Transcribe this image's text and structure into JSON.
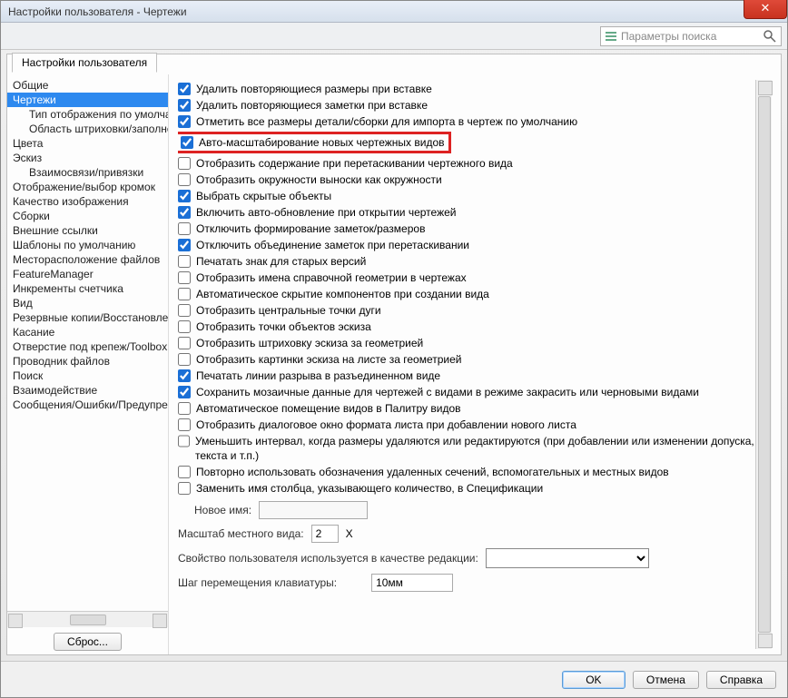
{
  "title": "Настройки пользователя - Чертежи",
  "search_placeholder": "Параметры поиска",
  "tab": "Настройки пользователя",
  "reset_label": "Сброс...",
  "sidebar": [
    {
      "label": "Общие",
      "sub": false,
      "sel": false
    },
    {
      "label": "Чертежи",
      "sub": false,
      "sel": true
    },
    {
      "label": "Тип отображения по умолчанию",
      "sub": true,
      "sel": false
    },
    {
      "label": "Область штриховки/заполнения",
      "sub": true,
      "sel": false
    },
    {
      "label": "Цвета",
      "sub": false,
      "sel": false
    },
    {
      "label": "Эскиз",
      "sub": false,
      "sel": false
    },
    {
      "label": "Взаимосвязи/привязки",
      "sub": true,
      "sel": false
    },
    {
      "label": "Отображение/выбор кромок",
      "sub": false,
      "sel": false
    },
    {
      "label": "Качество изображения",
      "sub": false,
      "sel": false
    },
    {
      "label": "Сборки",
      "sub": false,
      "sel": false
    },
    {
      "label": "Внешние ссылки",
      "sub": false,
      "sel": false
    },
    {
      "label": "Шаблоны по умолчанию",
      "sub": false,
      "sel": false
    },
    {
      "label": "Месторасположение файлов",
      "sub": false,
      "sel": false
    },
    {
      "label": "FeatureManager",
      "sub": false,
      "sel": false
    },
    {
      "label": "Инкременты счетчика",
      "sub": false,
      "sel": false
    },
    {
      "label": "Вид",
      "sub": false,
      "sel": false
    },
    {
      "label": "Резервные копии/Восстановление",
      "sub": false,
      "sel": false
    },
    {
      "label": "Касание",
      "sub": false,
      "sel": false
    },
    {
      "label": "Отверстие под крепеж/Toolbox",
      "sub": false,
      "sel": false
    },
    {
      "label": "Проводник файлов",
      "sub": false,
      "sel": false
    },
    {
      "label": "Поиск",
      "sub": false,
      "sel": false
    },
    {
      "label": "Взаимодействие",
      "sub": false,
      "sel": false
    },
    {
      "label": "Сообщения/Ошибки/Предупреждения",
      "sub": false,
      "sel": false
    }
  ],
  "options": [
    {
      "label": "Удалить повторяющиеся размеры при вставке",
      "checked": true,
      "hl": false
    },
    {
      "label": "Удалить повторяющиеся заметки при вставке",
      "checked": true,
      "hl": false
    },
    {
      "label": "Отметить все размеры детали/сборки для импорта в чертеж по умолчанию",
      "checked": true,
      "hl": false
    },
    {
      "label": "Авто-масштабирование новых чертежных видов",
      "checked": true,
      "hl": true
    },
    {
      "label": "Отобразить содержание при перетаскивании чертежного вида",
      "checked": false,
      "hl": false
    },
    {
      "label": "Отобразить окружности выноски как окружности",
      "checked": false,
      "hl": false
    },
    {
      "label": "Выбрать скрытые объекты",
      "checked": true,
      "hl": false
    },
    {
      "label": "Включить авто-обновление при открытии чертежей",
      "checked": true,
      "hl": false
    },
    {
      "label": "Отключить формирование заметок/размеров",
      "checked": false,
      "hl": false
    },
    {
      "label": "Отключить объединение заметок при перетаскивании",
      "checked": true,
      "hl": false
    },
    {
      "label": "Печатать знак для старых версий",
      "checked": false,
      "hl": false
    },
    {
      "label": "Отобразить имена справочной геометрии в чертежах",
      "checked": false,
      "hl": false
    },
    {
      "label": "Автоматическое скрытие компонентов при создании вида",
      "checked": false,
      "hl": false
    },
    {
      "label": "Отобразить центральные точки дуги",
      "checked": false,
      "hl": false
    },
    {
      "label": "Отобразить точки объектов эскиза",
      "checked": false,
      "hl": false
    },
    {
      "label": "Отобразить штриховку эскиза за геометрией",
      "checked": false,
      "hl": false
    },
    {
      "label": "Отобразить картинки эскиза на листе за геометрией",
      "checked": false,
      "hl": false
    },
    {
      "label": "Печатать линии разрыва в разъединенном виде",
      "checked": true,
      "hl": false
    },
    {
      "label": "Сохранить мозаичные данные для чертежей с видами в режиме закрасить или черновыми видами",
      "checked": true,
      "hl": false
    },
    {
      "label": "Автоматическое помещение видов в Палитру видов",
      "checked": false,
      "hl": false
    },
    {
      "label": "Отобразить диалоговое окно формата листа при добавлении нового листа",
      "checked": false,
      "hl": false
    },
    {
      "label": "Уменьшить интервал, когда размеры удаляются или редактируются (при добавлении или изменении допуска, текста и т.п.)",
      "checked": false,
      "hl": false
    },
    {
      "label": "Повторно использовать обозначения удаленных сечений, вспомогательных и местных видов",
      "checked": false,
      "hl": false
    },
    {
      "label": "Заменить имя столбца, указывающего количество, в Спецификации",
      "checked": false,
      "hl": false
    }
  ],
  "newname_label": "Новое имя:",
  "local_scale_label": "Масштаб местного вида:",
  "local_scale_value": "2",
  "local_scale_suffix": "X",
  "userprop_label": "Свойство пользователя используется в качестве редакции:",
  "kbstep_label": "Шаг перемещения клавиатуры:",
  "kbstep_value": "10мм",
  "footer": {
    "ok": "OK",
    "cancel": "Отмена",
    "help": "Справка"
  }
}
